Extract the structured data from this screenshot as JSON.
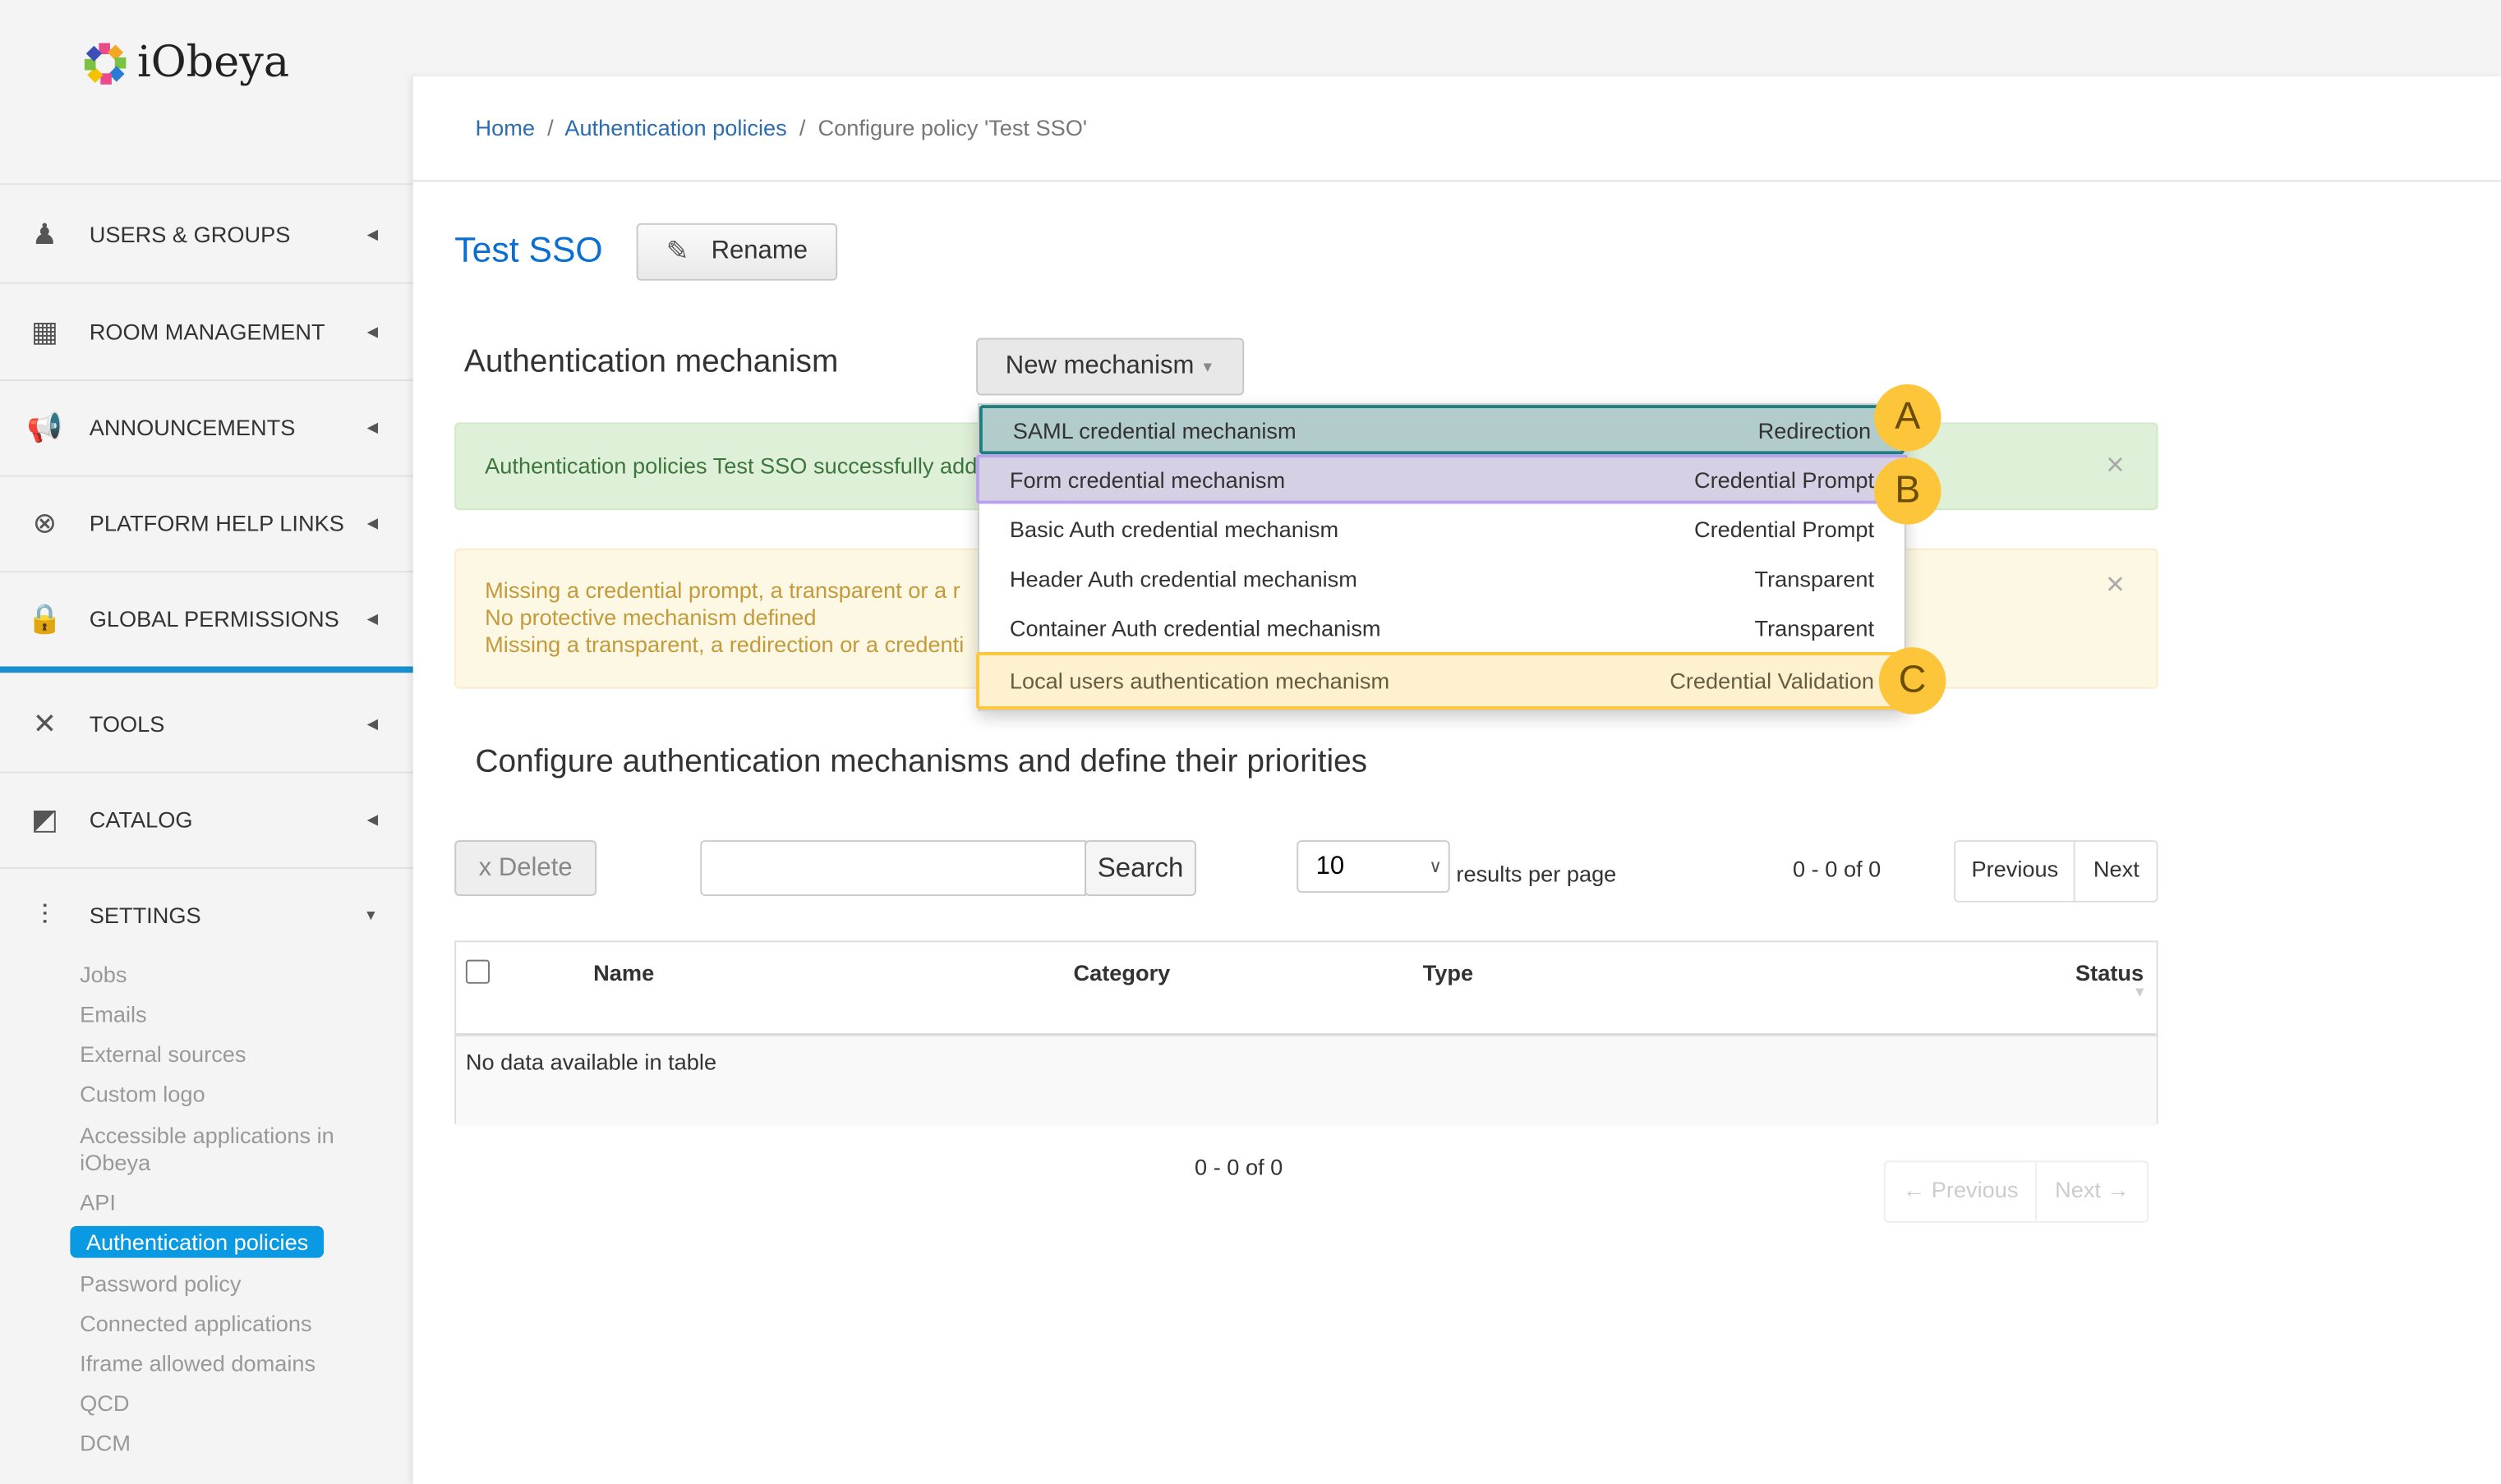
{
  "app": {
    "logo_text": "iObeya"
  },
  "sidebar": {
    "items": [
      {
        "label": "USERS & GROUPS",
        "icon": "user-icon"
      },
      {
        "label": "ROOM MANAGEMENT",
        "icon": "building-icon"
      },
      {
        "label": "ANNOUNCEMENTS",
        "icon": "megaphone-icon"
      },
      {
        "label": "PLATFORM HELP LINKS",
        "icon": "lifebuoy-icon"
      },
      {
        "label": "GLOBAL PERMISSIONS",
        "icon": "lock-icon"
      },
      {
        "label": "TOOLS",
        "icon": "tools-icon"
      },
      {
        "label": "CATALOG",
        "icon": "catalog-icon"
      },
      {
        "label": "SETTINGS",
        "icon": "sliders-icon"
      }
    ],
    "settings_sub": [
      "Jobs",
      "Emails",
      "External sources",
      "Custom logo",
      "Accessible applications in iObeya",
      "API",
      "Authentication policies",
      "Password policy",
      "Connected applications",
      "Iframe allowed domains",
      "QCD",
      "DCM"
    ],
    "active_sub": "Authentication policies"
  },
  "breadcrumb": {
    "home": "Home",
    "policies": "Authentication policies",
    "current": "Configure policy 'Test SSO'"
  },
  "policy": {
    "title": "Test SSO",
    "rename_label": "Rename"
  },
  "mechanism": {
    "heading": "Authentication mechanism",
    "new_label": "New mechanism",
    "menu": [
      {
        "name": "SAML credential mechanism",
        "type": "Redirection",
        "marker": "A"
      },
      {
        "name": "Form credential mechanism",
        "type": "Credential Prompt",
        "marker": "B"
      },
      {
        "name": "Basic Auth credential mechanism",
        "type": "Credential Prompt"
      },
      {
        "name": "Header Auth credential mechanism",
        "type": "Transparent"
      },
      {
        "name": "Container Auth credential mechanism",
        "type": "Transparent"
      },
      {
        "name": "Local users authentication mechanism",
        "type": "Credential Validation",
        "marker": "C"
      }
    ]
  },
  "alerts": {
    "success": "Authentication policies Test SSO successfully add",
    "warning": [
      "Missing a credential prompt, a transparent or a r",
      "No protective mechanism defined",
      "Missing a transparent, a redirection or a credenti"
    ],
    "close": "×"
  },
  "configure": {
    "heading": "Configure authentication mechanisms and define their priorities",
    "delete_label": "x Delete",
    "search_value": "",
    "search_label": "Search",
    "per_page": "10",
    "per_page_label": "results per page",
    "range": "0 - 0 of 0",
    "previous": "Previous",
    "next": "Next",
    "columns": [
      "Name",
      "Category",
      "Type",
      "Status"
    ],
    "empty": "No data available in table",
    "bottom_range": "0 - 0 of 0",
    "bottom_previous": "← Previous",
    "bottom_next": "Next →"
  },
  "colors": {
    "accent": "#0a9ae4",
    "marker_a": "#1f7e7e",
    "marker_b": "#b9a2ec",
    "marker_c": "#fdc63a"
  }
}
